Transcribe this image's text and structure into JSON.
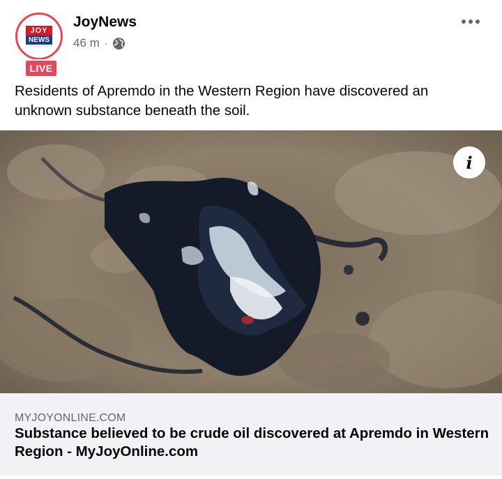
{
  "post": {
    "page_name": "JoyNews",
    "time": "46 m",
    "separator": "·",
    "privacy_icon": "globe-icon",
    "more_icon": "more-horizontal-icon",
    "live_badge": "LIVE",
    "logo_text_top": "JOY",
    "logo_text_bottom": "NEWS",
    "text": "Residents of Apremdo in the Western Region have discovered an unknown substance beneath the soil."
  },
  "photo": {
    "description_icon": "info-icon",
    "info_glyph": "i"
  },
  "link": {
    "domain": "MYJOYONLINE.COM",
    "title": "Substance believed to be crude oil discovered at Apremdo in Western Region - MyJoyOnline.com"
  },
  "colors": {
    "live_red": "#e4475a",
    "joy_red": "#d7182a",
    "news_blue": "#1c3a8a",
    "footer_bg": "#f0f2f5",
    "meta_gray": "#65676b"
  }
}
